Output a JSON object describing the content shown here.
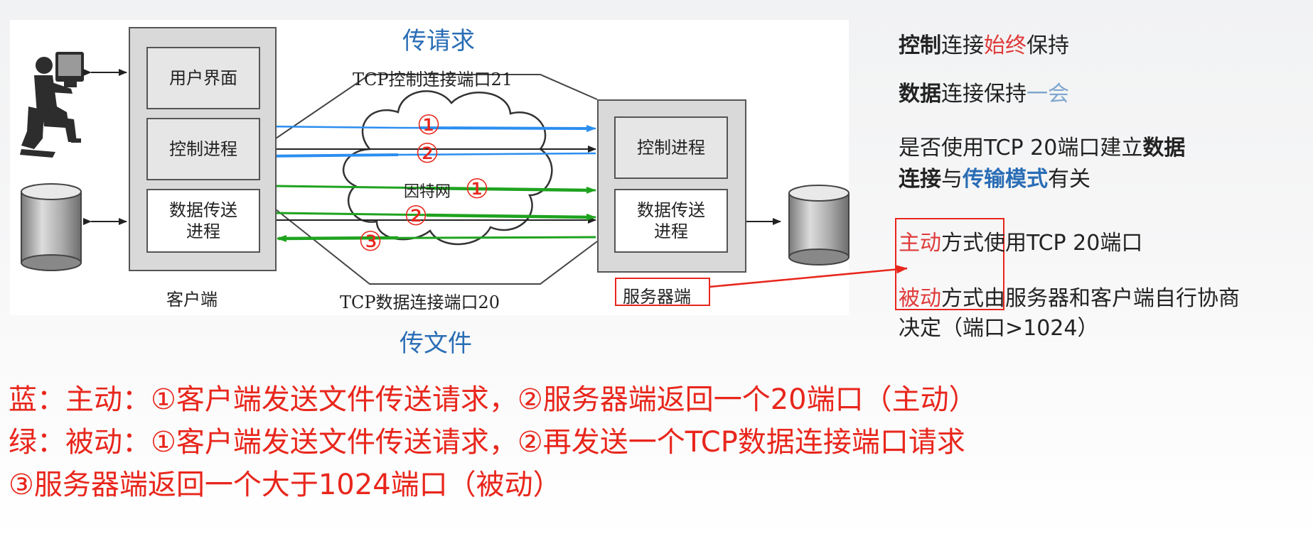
{
  "diagram": {
    "top_title": "传请求",
    "bottom_title": "传文件",
    "control_port_label": "TCP控制连接端口21",
    "data_port_label": "TCP数据连接端口20",
    "internet_label": "因特网",
    "client": {
      "label": "客户端",
      "ui": "用户界面",
      "control": "控制进程",
      "data": "数据传送\n进程"
    },
    "server": {
      "label": "服务器端",
      "control": "控制进程",
      "data": "数据传送\n进程"
    },
    "markers": [
      "①",
      "②",
      "①",
      "②",
      "③"
    ]
  },
  "notes": {
    "line1": {
      "a": "控制",
      "b": "连接",
      "c": "始终",
      "d": "保持"
    },
    "line2": {
      "a": "数据",
      "b": "连接保持",
      "c": "一会"
    },
    "line3": {
      "a": "是否使用TCP 20端口建立",
      "b": "数据"
    },
    "line4": {
      "a": "连接",
      "b": "与",
      "c": "传输模式",
      "d": "有关"
    },
    "line5": {
      "a": "主动",
      "b": "方式",
      "c": "使用TCP 20端口"
    },
    "line6": {
      "a": "被动",
      "b": "方式",
      "c": "由服务器和客户端自行协商"
    },
    "line7": "决定（端口>1024）"
  },
  "bottom": {
    "line1": "蓝：主动：①客户端发送文件传送请求，②服务器端返回一个20端口（主动）",
    "line2": "绿：被动：①客户端发送文件传送请求，②再发送一个TCP数据连接端口请求",
    "line3": "③服务器端返回一个大于1024端口（被动）"
  },
  "colors": {
    "blue_arrow": "#2b8ef0",
    "green_arrow": "#1fa31f",
    "red_annotation": "#e8261c",
    "title_blue": "#2a6db5"
  }
}
